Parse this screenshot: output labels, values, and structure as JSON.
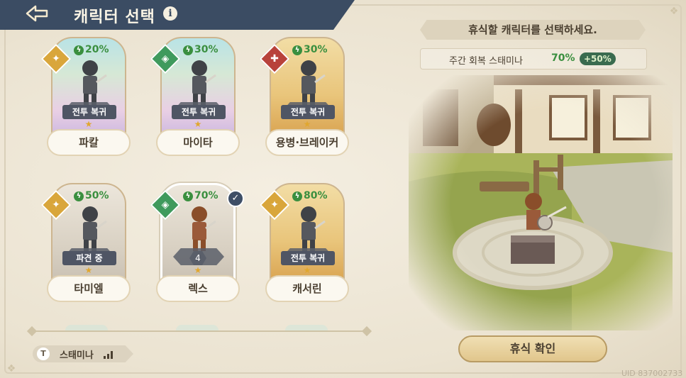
{
  "header": {
    "title": "캐릭터 선택",
    "back_icon": "back-arrow-icon",
    "info_icon": "i"
  },
  "cards": [
    {
      "name": "파칼",
      "stamina": "20%",
      "status": "전투 복귀",
      "level": "",
      "badge": "gold",
      "bg": "rainbow",
      "selected": false,
      "star": "★"
    },
    {
      "name": "마이타",
      "stamina": "30%",
      "status": "전투 복귀",
      "level": "",
      "badge": "green",
      "bg": "rainbow",
      "selected": false,
      "star": "★"
    },
    {
      "name": "용병·브레이커",
      "stamina": "30%",
      "status": "전투 복귀",
      "level": "",
      "badge": "red",
      "bg": "gold",
      "selected": false,
      "star": "★"
    },
    {
      "name": "타미엘",
      "stamina": "50%",
      "status": "파견 중",
      "level": "",
      "badge": "gold",
      "bg": "gray",
      "selected": false,
      "star": "★"
    },
    {
      "name": "렉스",
      "stamina": "70%",
      "status": "",
      "level": "4",
      "badge": "green",
      "bg": "gray",
      "selected": true,
      "star": "★"
    },
    {
      "name": "캐서린",
      "stamina": "80%",
      "status": "전투 복귀",
      "level": "",
      "badge": "gold",
      "bg": "gold",
      "selected": false,
      "star": "★"
    }
  ],
  "footer": {
    "stamina_label": "스태미나",
    "stamina_icon": "T"
  },
  "right": {
    "banner": "휴식할 캐릭터를 선택하세요.",
    "weekly_label": "주간 회복 스태미나",
    "weekly_value": "70%",
    "weekly_bonus": "+50%",
    "confirm": "휴식 확인"
  },
  "uid": "UID 837002733",
  "colors": {
    "header": "#3b4c63",
    "stamina_green": "#3a8f3f",
    "confirm_gold": "#e1c68c"
  }
}
